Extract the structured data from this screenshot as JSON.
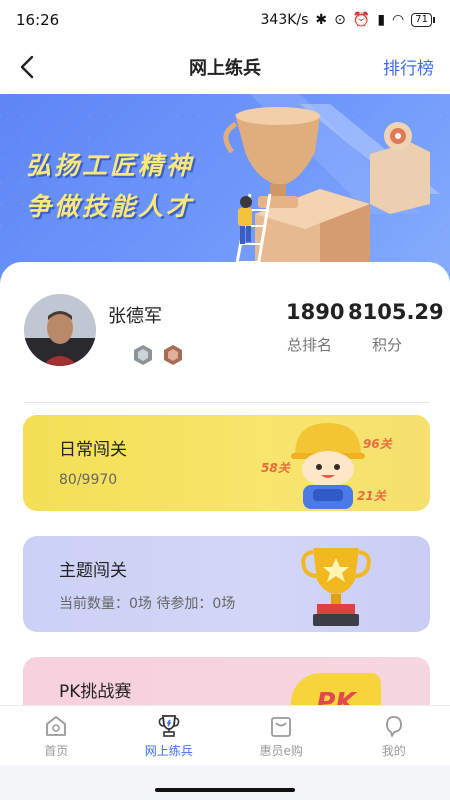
{
  "status_bar": {
    "time": "16:26",
    "network_speed": "343K/s",
    "battery": "71"
  },
  "nav": {
    "title": "网上练兵",
    "right_link": "排行榜"
  },
  "banner": {
    "line1": "弘扬工匠精神",
    "line2": "争做技能人才"
  },
  "user": {
    "name": "张德军",
    "rank_value": "1890",
    "rank_label": "总排名",
    "score_value": "8105.29",
    "score_label": "积分"
  },
  "modes": {
    "daily": {
      "title": "日常闯关",
      "progress": "80/9970",
      "levels": [
        "96关",
        "58关",
        "21关"
      ]
    },
    "theme": {
      "title": "主题闯关",
      "info": "当前数量：0场 待参加：0场"
    },
    "pk": {
      "title": "PK挑战赛",
      "logo_text": "PK"
    }
  },
  "tabs": [
    {
      "label": "首页",
      "icon": "home-icon"
    },
    {
      "label": "网上练兵",
      "icon": "trophy-icon",
      "active": true
    },
    {
      "label": "惠员e购",
      "icon": "shopping-bag-icon"
    },
    {
      "label": "我的",
      "icon": "profile-icon"
    }
  ],
  "colors": {
    "accent": "#3e6ee8",
    "banner": "#6f98fb",
    "daily_card": "#f6e15f",
    "theme_card": "#cfd3f6",
    "pk_card": "#f7d3de"
  }
}
